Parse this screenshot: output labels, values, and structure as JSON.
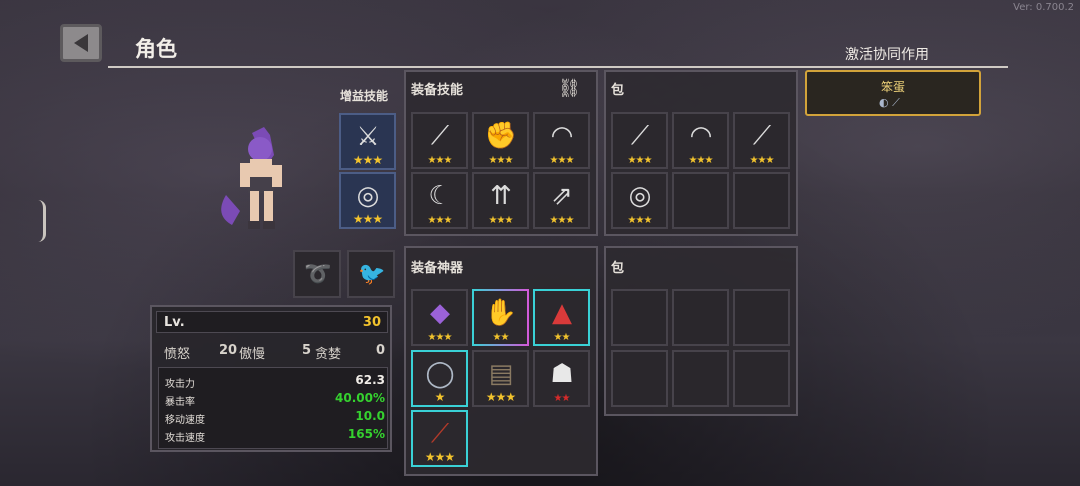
{
  "version": "Ver: 0.700.2",
  "header": {
    "title": "角色"
  },
  "synergy": {
    "title": "激活协同作用",
    "name": "笨蛋"
  },
  "buff_skills": {
    "label": "增益技能",
    "slots": [
      {
        "icon": "crossed-blades-icon",
        "stars": "★★★"
      },
      {
        "icon": "spiral-shield-icon",
        "stars": "★★★"
      }
    ]
  },
  "equip_skills": {
    "label": "装备技能",
    "slots": [
      {
        "icon": "slash-icon",
        "stars": "★★★"
      },
      {
        "icon": "fist-icon",
        "stars": "★★★"
      },
      {
        "icon": "whirl-slash-icon",
        "stars": "★★★"
      },
      {
        "icon": "crescent-slash-icon",
        "stars": "★★★"
      },
      {
        "icon": "triple-arrow-icon",
        "stars": "★★★"
      },
      {
        "icon": "arrow-burst-icon",
        "stars": "★★★"
      }
    ]
  },
  "skill_bag": {
    "label": "包",
    "slots": [
      {
        "icon": "slash-icon",
        "stars": "★★★"
      },
      {
        "icon": "whirl-slash-icon",
        "stars": "★★★"
      },
      {
        "icon": "slash-icon",
        "stars": "★★★"
      },
      {
        "icon": "spiral-shield-icon",
        "stars": "★★★"
      }
    ]
  },
  "equip_artifacts": {
    "label": "装备神器",
    "slots": [
      {
        "icon": "purple-crystal-icon",
        "stars": "★★★"
      },
      {
        "icon": "gauntlet-icon",
        "stars": "★★"
      },
      {
        "icon": "red-cape-icon",
        "stars": "★★"
      },
      {
        "icon": "ring-icon",
        "stars": "★"
      },
      {
        "icon": "barrel-icon",
        "stars": "★★★"
      },
      {
        "icon": "mask-icon",
        "stars": "★★"
      },
      {
        "icon": "red-club-icon",
        "stars": "★★★"
      }
    ]
  },
  "artifact_bag": {
    "label": "包"
  },
  "stats": {
    "lv_label": "Lv.",
    "lv_value": "30",
    "traits": [
      {
        "name": "愤怒",
        "value": "20"
      },
      {
        "name": "傲慢",
        "value": "5"
      },
      {
        "name": "贪婪",
        "value": "0"
      }
    ],
    "attributes": [
      {
        "name": "攻击力",
        "value": "62.3"
      },
      {
        "name": "暴击率",
        "value": "40.00%"
      },
      {
        "name": "移动速度",
        "value": "10.0"
      },
      {
        "name": "攻击速度",
        "value": "165%"
      }
    ]
  }
}
